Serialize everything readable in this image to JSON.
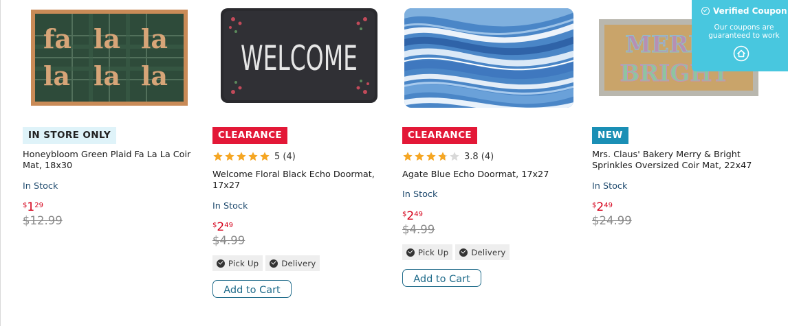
{
  "products": [
    {
      "badge": "IN STORE ONLY",
      "title_line1": "Honeybloom Green Plaid Fa La La Coir",
      "title_line2": "Mat, 18x30",
      "stock": "In Stock",
      "price_currency": "$",
      "price_dollars": "1",
      "price_cents": "29",
      "original_price": "$12.99",
      "image_words": [
        "fa",
        "la",
        "la",
        "la",
        "la",
        "la"
      ]
    },
    {
      "badge": "CLEARANCE",
      "rating_stars": 5,
      "rating_text": "5 (4)",
      "title_line1": "Welcome Floral Black Echo Doormat,",
      "title_line2": "17x27",
      "stock": "In Stock",
      "price_currency": "$",
      "price_dollars": "2",
      "price_cents": "49",
      "original_price": "$4.99",
      "pickup_label": "Pick Up",
      "delivery_label": "Delivery",
      "cart_label": "Add to Cart",
      "image_words": [
        "WELCOME"
      ]
    },
    {
      "badge": "CLEARANCE",
      "rating_stars": 3.8,
      "rating_text": "3.8 (4)",
      "title_line1": "Agate Blue Echo Doormat, 17x27",
      "stock": "In Stock",
      "price_currency": "$",
      "price_dollars": "2",
      "price_cents": "49",
      "original_price": "$4.99",
      "pickup_label": "Pick Up",
      "delivery_label": "Delivery",
      "cart_label": "Add to Cart"
    },
    {
      "badge": "NEW",
      "title_line1": "Mrs. Claus' Bakery Merry & Bright",
      "title_line2": "Sprinkles Oversized Coir Mat, 22x47",
      "stock": "In Stock",
      "price_currency": "$",
      "price_dollars": "2",
      "price_cents": "49",
      "original_price": "$24.99",
      "image_words": [
        "MERRY",
        "BRIGHT"
      ]
    }
  ],
  "coupon": {
    "title": "Verified Coupon",
    "subtitle_line1": "Our coupons are",
    "subtitle_line2": "guaranteed to work"
  },
  "colors": {
    "clearance_badge": "#e31837",
    "new_badge": "#1a8fb5",
    "instore_badge": "#dff3f9",
    "sale_price": "#d5001a",
    "stock_text": "#1f4a6e",
    "star": "#f5a623",
    "coupon_bg": "#48c7df"
  }
}
